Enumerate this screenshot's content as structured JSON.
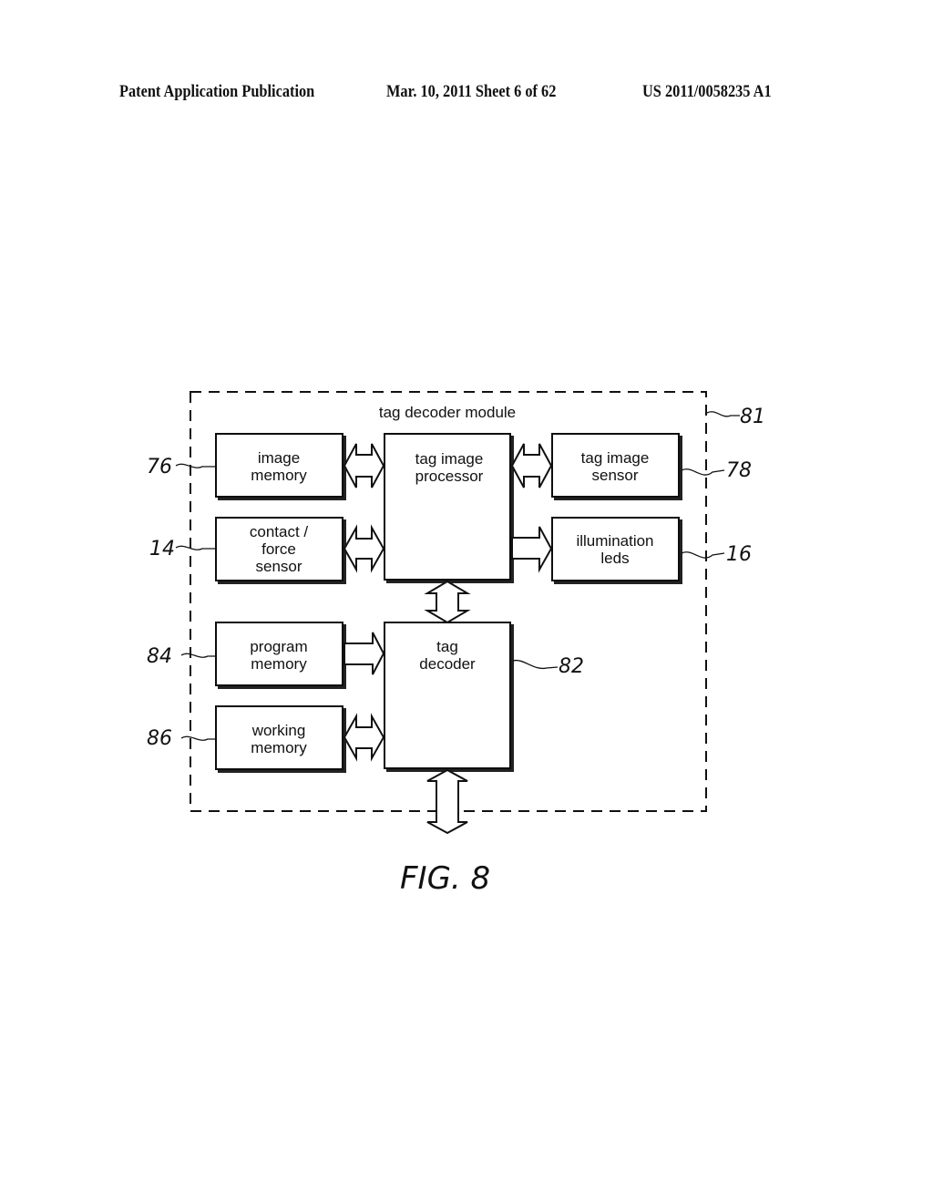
{
  "header": {
    "left": "Patent Application Publication",
    "center": "Mar. 10, 2011  Sheet 6 of 62",
    "right": "US 2011/0058235 A1"
  },
  "diagram": {
    "module_label": "tag decoder module",
    "module_ref": "81",
    "blocks": {
      "image_memory": {
        "lines": [
          "image",
          "memory"
        ],
        "ref": "76"
      },
      "contact_force_sensor": {
        "lines": [
          "contact /",
          "force",
          "sensor"
        ],
        "ref": "14"
      },
      "tag_image_processor": {
        "lines": [
          "tag image",
          "processor"
        ]
      },
      "tag_image_sensor": {
        "lines": [
          "tag image",
          "sensor"
        ],
        "ref": "78"
      },
      "illumination_leds": {
        "lines": [
          "illumination",
          "leds"
        ],
        "ref": "16"
      },
      "program_memory": {
        "lines": [
          "program",
          "memory"
        ],
        "ref": "84"
      },
      "working_memory": {
        "lines": [
          "working",
          "memory"
        ],
        "ref": "86"
      },
      "tag_decoder": {
        "lines": [
          "tag",
          "decoder"
        ],
        "ref": "82"
      }
    },
    "connections": [
      {
        "from": "image_memory",
        "to": "tag_image_processor",
        "direction": "bidirectional"
      },
      {
        "from": "contact_force_sensor",
        "to": "tag_image_processor",
        "direction": "bidirectional"
      },
      {
        "from": "tag_image_processor",
        "to": "tag_image_sensor",
        "direction": "bidirectional"
      },
      {
        "from": "tag_image_processor",
        "to": "illumination_leds",
        "direction": "one-way"
      },
      {
        "from": "tag_image_processor",
        "to": "tag_decoder",
        "direction": "bidirectional"
      },
      {
        "from": "program_memory",
        "to": "tag_decoder",
        "direction": "one-way"
      },
      {
        "from": "working_memory",
        "to": "tag_decoder",
        "direction": "bidirectional"
      },
      {
        "from": "tag_decoder",
        "to": "external",
        "direction": "bidirectional"
      }
    ],
    "figure_caption": "FIG. 8"
  }
}
